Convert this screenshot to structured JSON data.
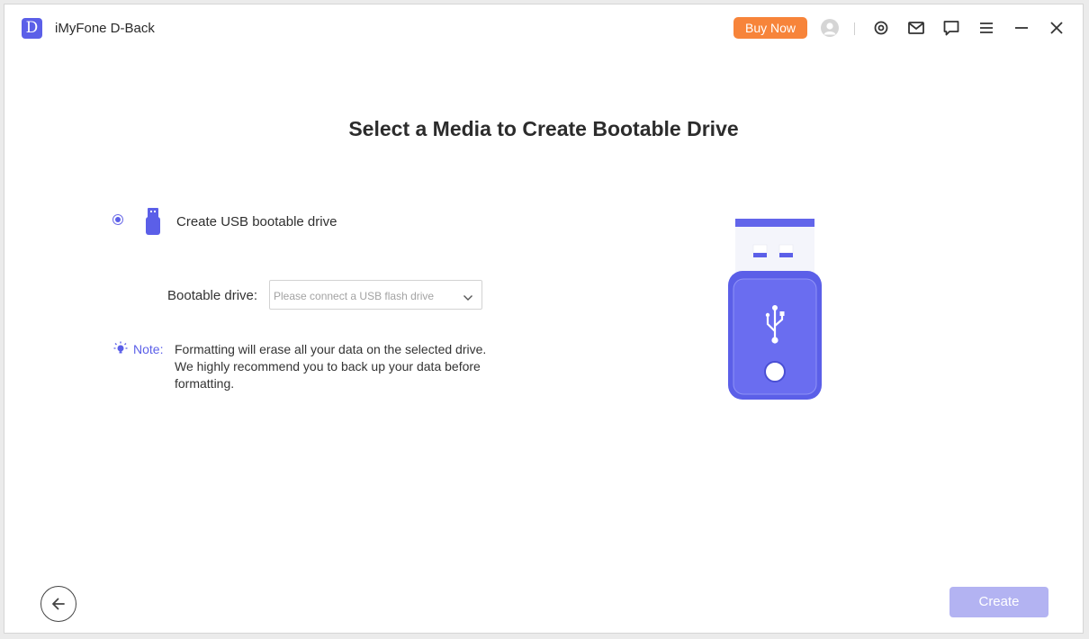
{
  "app": {
    "logo_letter": "D",
    "title": "iMyFone D-Back"
  },
  "toolbar": {
    "buy_now_label": "Buy Now",
    "icons": [
      "user-avatar-icon",
      "settings-icon",
      "mail-icon",
      "feedback-icon",
      "menu-icon",
      "minimize-icon",
      "close-icon"
    ]
  },
  "main": {
    "title": "Select a Media to Create Bootable Drive",
    "option": {
      "label": "Create USB bootable drive",
      "selected": true
    },
    "bootable_drive": {
      "label": "Bootable drive:",
      "placeholder": "Please connect a USB flash drive"
    },
    "note": {
      "label": "Note:",
      "text": "Formatting will erase all your data on the selected drive. We highly recommend you to back up your data before formatting."
    }
  },
  "footer": {
    "create_label": "Create",
    "create_enabled": false
  },
  "colors": {
    "accent": "#5b5fe8",
    "buy_now": "#f7843a",
    "create_disabled": "#b3b3f2",
    "usb_body": "#5b5fe8"
  }
}
